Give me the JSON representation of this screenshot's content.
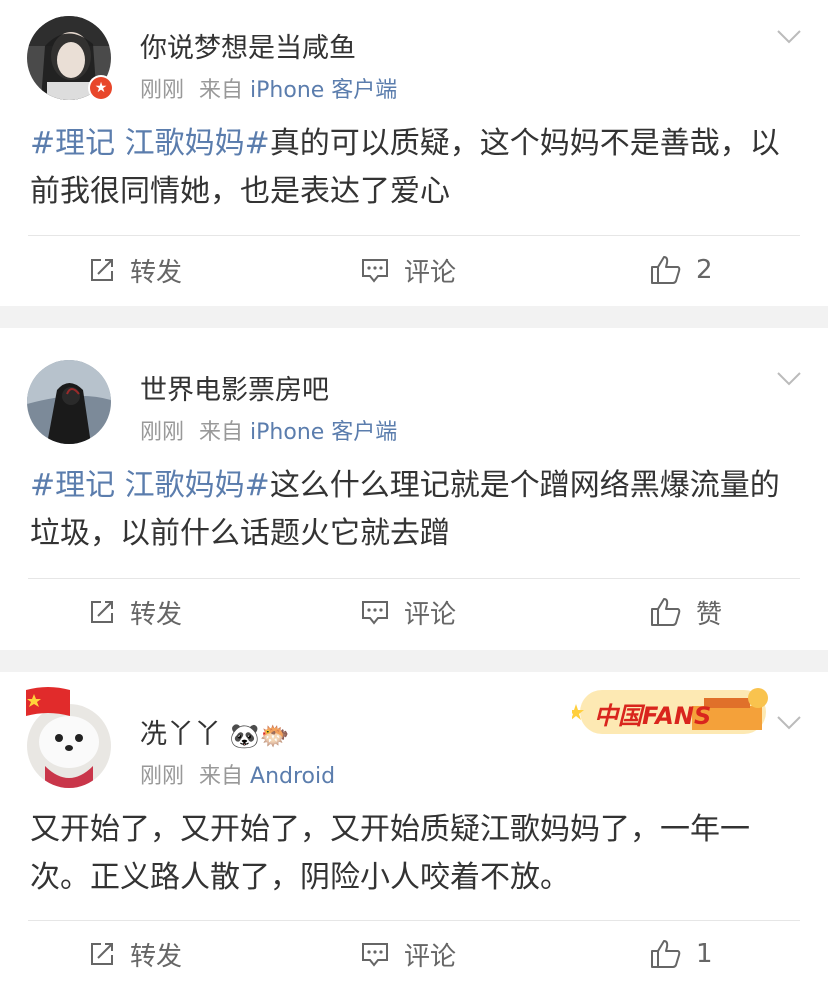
{
  "posts": [
    {
      "username": "你说梦想是当咸鱼",
      "time": "刚刚",
      "from": "来自",
      "source": "iPhone 客户端",
      "hashtag": "#理记 江歌妈妈#",
      "text": "真的可以质疑，这个妈妈不是善哉，以前我很同情她，也是表达了爱心",
      "repost_label": "转发",
      "comment_label": "评论",
      "like_label": "2"
    },
    {
      "username": "世界电影票房吧",
      "time": "刚刚",
      "from": "来自",
      "source": "iPhone 客户端",
      "hashtag": "#理记 江歌妈妈#",
      "text": "这么什么理记就是个蹭网络黑爆流量的垃圾，以前什么话题火它就去蹭",
      "repost_label": "转发",
      "comment_label": "评论",
      "like_label": "赞"
    },
    {
      "username": "冼丫丫",
      "username_emoji": "🐼🐡",
      "time": "刚刚",
      "from": "来自",
      "source": "Android",
      "badge_text": "中国FANS",
      "text": "又开始了，又开始了，又开始质疑江歌妈妈了，一年一次。正义路人散了，阴险小人咬着不放。",
      "repost_label": "转发",
      "comment_label": "评论",
      "like_label": "1"
    }
  ],
  "colors": {
    "link": "#5b7dad",
    "meta": "#999999",
    "background": "#f2f2f2",
    "verified": "#e8462a"
  },
  "icons": [
    "repost-icon",
    "comment-icon",
    "like-icon",
    "chevron-down-icon",
    "verified-icon",
    "china-flag-icon"
  ]
}
